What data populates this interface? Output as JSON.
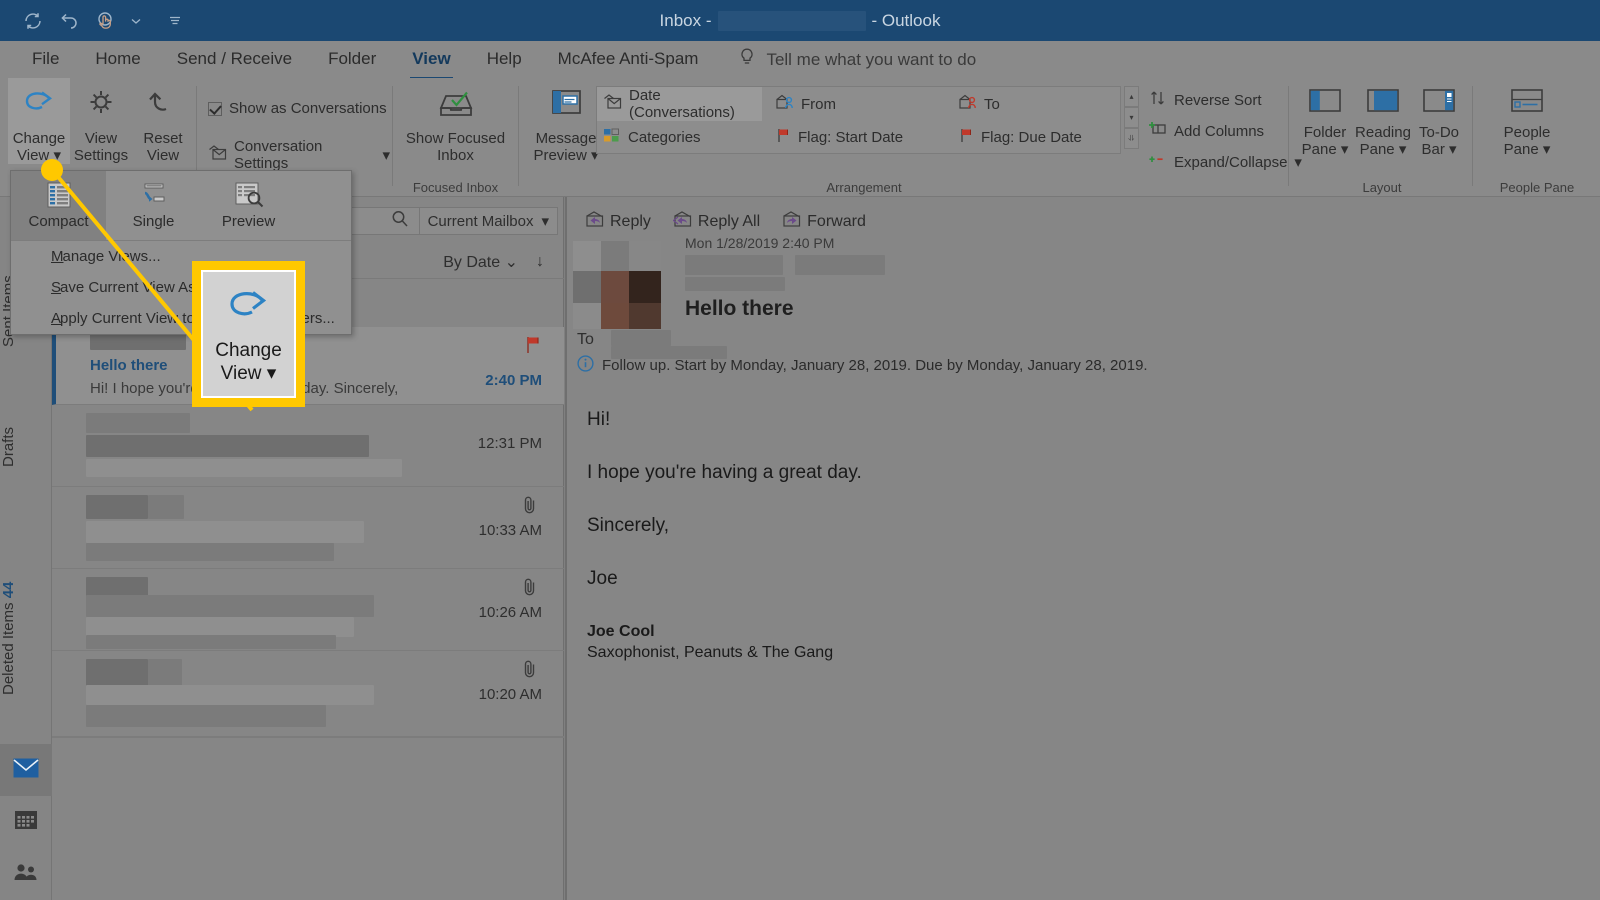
{
  "titlebar": {
    "quick_access": [
      "refresh-icon",
      "undo-icon",
      "touch-mode-icon",
      "customize-chevron-icon",
      "ribbon-options-icon"
    ],
    "title_prefix": "Inbox -",
    "title_suffix": "- Outlook",
    "account_redacted": true
  },
  "tabs": [
    {
      "label": "File",
      "active": false
    },
    {
      "label": "Home",
      "active": false
    },
    {
      "label": "Send / Receive",
      "active": false
    },
    {
      "label": "Folder",
      "active": false
    },
    {
      "label": "View",
      "active": true
    },
    {
      "label": "Help",
      "active": false
    },
    {
      "label": "McAfee Anti-Spam",
      "active": false
    }
  ],
  "tell_me": {
    "placeholder": "Tell me what you want to do",
    "icon": "lightbulb-icon"
  },
  "ribbon": {
    "current_view_group": {
      "label": "",
      "buttons": [
        {
          "label_line1": "Change",
          "label_line2": "View",
          "icon": "change-view-arrow-icon",
          "has_dropdown": true,
          "selected": true
        },
        {
          "label_line1": "View",
          "label_line2": "Settings",
          "icon": "gear-icon",
          "has_dropdown": false,
          "selected": false
        },
        {
          "label_line1": "Reset",
          "label_line2": "View",
          "icon": "reset-undo-icon",
          "has_dropdown": false,
          "selected": false
        }
      ]
    },
    "messages_group": {
      "show_as_conversations": {
        "label": "Show as Conversations",
        "checked": true
      },
      "conversation_settings": {
        "label": "Conversation Settings",
        "icon": "conversation-icon",
        "has_dropdown": true
      }
    },
    "focused_inbox_group": {
      "label": "Focused Inbox",
      "button": {
        "label_line1": "Show Focused",
        "label_line2": "Inbox",
        "icon": "focused-inbox-icon"
      }
    },
    "arrangement_group": {
      "label": "Arrangement",
      "message_preview": {
        "label_line1": "Message",
        "label_line2": "Preview",
        "icon": "message-preview-icon",
        "has_dropdown": true
      },
      "items": [
        {
          "label": "Date (Conversations)",
          "icon": "date-conversations-icon",
          "selected": true
        },
        {
          "label": "From",
          "icon": "from-person-icon",
          "selected": false
        },
        {
          "label": "To",
          "icon": "to-person-icon",
          "selected": false
        },
        {
          "label": "Categories",
          "icon": "categories-icon",
          "selected": false
        },
        {
          "label": "Flag: Start Date",
          "icon": "flag-icon",
          "selected": false
        },
        {
          "label": "Flag: Due Date",
          "icon": "flag-icon",
          "selected": false
        }
      ],
      "side_commands": [
        {
          "label": "Reverse Sort",
          "icon": "reverse-sort-icon",
          "has_dropdown": false
        },
        {
          "label": "Add Columns",
          "icon": "add-columns-icon",
          "has_dropdown": false
        },
        {
          "label": "Expand/Collapse",
          "icon": "expand-collapse-icon",
          "has_dropdown": true
        }
      ]
    },
    "layout_group": {
      "label": "Layout",
      "buttons": [
        {
          "label_line1": "Folder",
          "label_line2": "Pane",
          "icon": "folder-pane-icon",
          "has_dropdown": true
        },
        {
          "label_line1": "Reading",
          "label_line2": "Pane",
          "icon": "reading-pane-icon",
          "has_dropdown": true
        },
        {
          "label_line1": "To-Do",
          "label_line2": "Bar",
          "icon": "todo-bar-icon",
          "has_dropdown": true
        }
      ]
    },
    "people_pane_group": {
      "label": "People Pane",
      "buttons": [
        {
          "label_line1": "People",
          "label_line2": "Pane",
          "icon": "people-pane-icon",
          "has_dropdown": true
        }
      ]
    }
  },
  "change_view_dropdown": {
    "gallery": [
      {
        "label": "Compact",
        "icon": "compact-view-icon",
        "selected": true
      },
      {
        "label": "Single",
        "icon": "single-view-icon",
        "selected": false
      },
      {
        "label": "Preview",
        "icon": "preview-view-icon",
        "selected": false
      }
    ],
    "menu_items": [
      "Manage Views...",
      "Save Current View As a New View...",
      "Apply Current View to Other Mail Folders..."
    ]
  },
  "callout": {
    "label_line1": "Change",
    "label_line2": "View",
    "icon": "change-view-arrow-icon",
    "highlight_color": "#FFC800"
  },
  "folder_rail": {
    "items": [
      {
        "label": "Sent Items",
        "count": ""
      },
      {
        "label": "Drafts",
        "count": ""
      },
      {
        "label": "Deleted Items",
        "count": "44"
      }
    ],
    "nav": [
      {
        "name": "mail",
        "icon": "mail-icon",
        "selected": true
      },
      {
        "name": "calendar",
        "icon": "calendar-icon",
        "selected": false
      },
      {
        "name": "people",
        "icon": "people-icon",
        "selected": false
      }
    ]
  },
  "message_list": {
    "search_placeholder": "",
    "search_icon": "search-icon",
    "scope": "Current Mailbox",
    "sort_by": "By Date",
    "sort_direction_icon": "arrow-down-icon",
    "rows": [
      {
        "sender_redacted": true,
        "subject": "Hello there",
        "preview": "Hi!   I hope you're having a great day.  Sincerely,",
        "time": "2:40 PM",
        "flagged": true,
        "has_attachment": false,
        "selected": true
      },
      {
        "sender_redacted": true,
        "subject": "",
        "preview": "",
        "time": "12:31 PM",
        "flagged": false,
        "has_attachment": false,
        "selected": false
      },
      {
        "sender_redacted": true,
        "subject": "",
        "preview": "",
        "time": "10:33 AM",
        "flagged": false,
        "has_attachment": true,
        "selected": false
      },
      {
        "sender_redacted": true,
        "subject": "",
        "preview": "",
        "time": "10:26 AM",
        "flagged": false,
        "has_attachment": true,
        "selected": false
      },
      {
        "sender_redacted": true,
        "subject": "",
        "preview": "",
        "time": "10:20 AM",
        "flagged": false,
        "has_attachment": true,
        "selected": false
      }
    ]
  },
  "reading_pane": {
    "actions": [
      {
        "label": "Reply",
        "icon": "reply-icon"
      },
      {
        "label": "Reply All",
        "icon": "reply-all-icon"
      },
      {
        "label": "Forward",
        "icon": "forward-icon"
      }
    ],
    "date": "Mon 1/28/2019 2:40 PM",
    "subject": "Hello there",
    "to_label": "To",
    "follow_up": "Follow up.  Start by Monday, January 28, 2019.  Due by Monday, January 28, 2019.",
    "follow_up_icon": "info-icon",
    "body_paragraphs": [
      "Hi!",
      "I hope you're having a great day.",
      "Sincerely,",
      "Joe"
    ],
    "signature_name": "Joe Cool",
    "signature_role": "Saxophonist, Peanuts & The Gang"
  },
  "colors": {
    "titlebar": "#1b4872",
    "accent_blue": "#1f4e79",
    "highlight_yellow": "#FFC800",
    "overlay_gray": "#808080"
  }
}
